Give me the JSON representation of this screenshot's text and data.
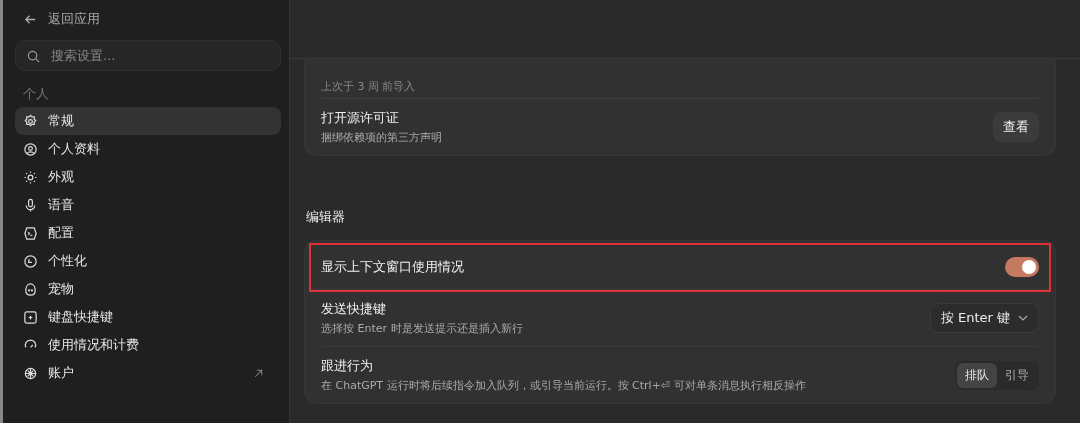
{
  "sidebar": {
    "back": "返回应用",
    "search": {
      "placeholder": "搜索设置..."
    },
    "section": "个人",
    "items": [
      {
        "label": "常规",
        "selected": true
      },
      {
        "label": "个人资料",
        "selected": false
      },
      {
        "label": "外观",
        "selected": false
      },
      {
        "label": "语音",
        "selected": false
      },
      {
        "label": "配置",
        "selected": false
      },
      {
        "label": "个性化",
        "selected": false
      },
      {
        "label": "宠物",
        "selected": false
      },
      {
        "label": "键盘快捷键",
        "selected": false
      },
      {
        "label": "使用情况和计费",
        "selected": false
      },
      {
        "label": "账户",
        "selected": false,
        "external": true
      }
    ]
  },
  "main": {
    "top_card": {
      "note": "上次于 3 周 前导入",
      "rows": [
        {
          "title": "打开源许可证",
          "description": "捆绑依赖项的第三方声明",
          "kind": "button",
          "button": "查看"
        }
      ]
    },
    "section": "编辑器",
    "rows": [
      {
        "kind": "toggle",
        "title": "显示上下文窗口使用情况",
        "on": true,
        "highlighted": true
      },
      {
        "kind": "dropdown",
        "title": "发送快捷键",
        "description": "选择按 Enter 时是发送提示还是插入新行",
        "value": "按 Enter 键",
        "highlighted": false
      },
      {
        "kind": "segmented",
        "title": "跟进行为",
        "description": "在 ChatGPT 运行时将后续指令加入队列，或引导当前运行。按 Ctrl+⏎ 可对单条消息执行相反操作",
        "options": [
          {
            "label": "排队",
            "selected": true
          },
          {
            "label": "引导",
            "selected": false
          }
        ],
        "highlighted": false
      }
    ]
  }
}
